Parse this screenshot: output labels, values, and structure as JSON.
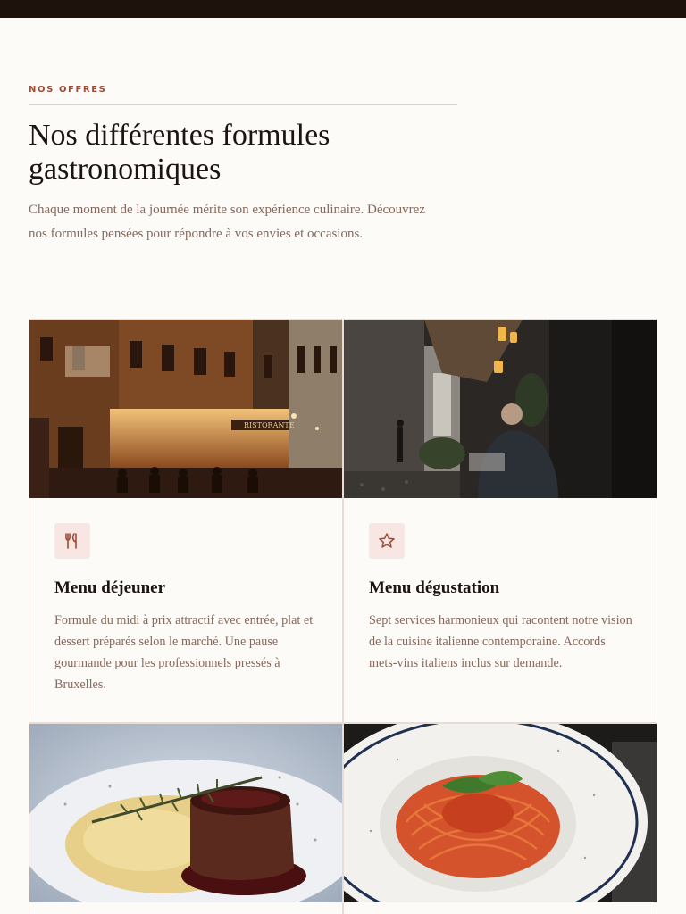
{
  "section": {
    "eyebrow": "NOS OFFRES",
    "title": "Nos différentes formules gastronomiques",
    "intro": "Chaque moment de la journée mérite son expérience culinaire. Découvrez nos formules pensées pour répondre à vos envies et occasions."
  },
  "cards": [
    {
      "title": "Menu déjeuner",
      "description": "Formule du midi à prix attractif avec entrée, plat et dessert préparés selon le marché. Une pause gourmande pour les professionnels pressés à Bruxelles.",
      "icon": "utensils-icon",
      "photo": "night-street-restaurant-terrace-photo"
    },
    {
      "title": "Menu dégustation",
      "description": "Sept services harmonieux qui racontent notre vision de la cuisine italienne contemporaine. Accords mets-vins italiens inclus sur demande.",
      "icon": "star-icon",
      "photo": "man-dining-in-alley-photo"
    },
    {
      "photo": "steak-with-risotto-photo"
    },
    {
      "photo": "spaghetti-tomato-basil-photo"
    }
  ],
  "photo_signs": {
    "restaurant_sign": "RISTORANTE"
  },
  "colors": {
    "accent": "#a14a36",
    "text_muted": "#86685c",
    "icon_bg": "#f7e6e1",
    "background": "#fdfbf8",
    "topbar": "#1e120d"
  }
}
